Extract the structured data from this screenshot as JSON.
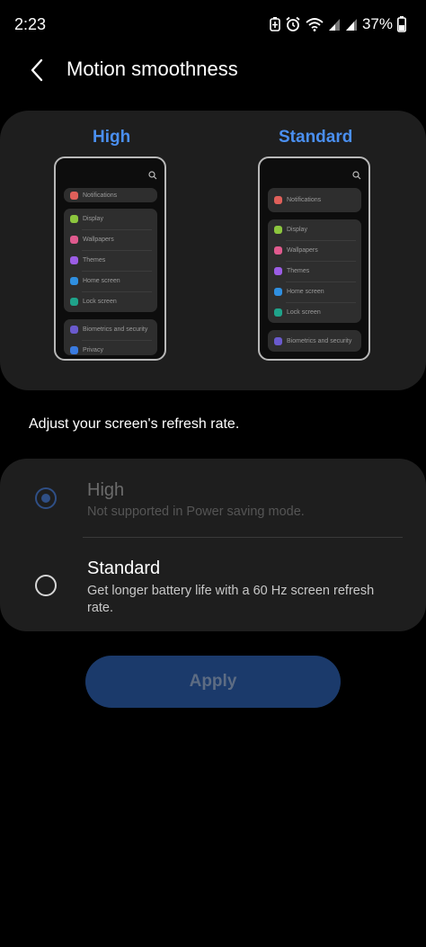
{
  "status": {
    "time": "2:23",
    "battery": "37%"
  },
  "header": {
    "title": "Motion smoothness",
    "back_icon": "chevron-left-icon"
  },
  "preview": {
    "left_label": "High",
    "right_label": "Standard",
    "high_items": {
      "notifications": "Notifications",
      "display": "Display",
      "wallpapers": "Wallpapers",
      "themes": "Themes",
      "home": "Home screen",
      "lock": "Lock screen",
      "biometrics": "Biometrics and security",
      "privacy": "Privacy"
    },
    "standard_items": {
      "notifications": "Notifications",
      "display": "Display",
      "wallpapers": "Wallpapers",
      "themes": "Themes",
      "home": "Home screen",
      "lock": "Lock screen",
      "biometrics": "Biometrics and security"
    }
  },
  "description": "Adjust your screen's refresh rate.",
  "options": {
    "high": {
      "title": "High",
      "subtitle": "Not supported in Power saving mode.",
      "selected": true
    },
    "standard": {
      "title": "Standard",
      "subtitle": "Get longer battery life with a 60 Hz screen refresh rate.",
      "selected": false
    }
  },
  "apply_label": "Apply",
  "colors": {
    "accent": "#4a8ff0",
    "card": "#1e1e1e",
    "apply_bg": "#1b3a6b",
    "icon_notifications": "#e0605a",
    "icon_display": "#8cc63e",
    "icon_wallpapers": "#e05a8e",
    "icon_themes": "#9b5de5",
    "icon_home": "#2f8fe0",
    "icon_lock": "#1fa38a",
    "icon_biometrics": "#6a5acd",
    "icon_privacy": "#3a7be0"
  }
}
